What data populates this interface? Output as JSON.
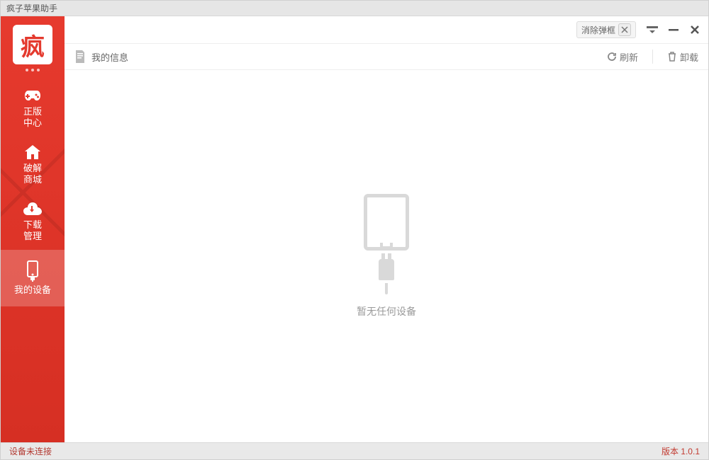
{
  "window": {
    "title": "疯子苹果助手"
  },
  "sidebar": {
    "items": [
      {
        "label": "正版\n中心"
      },
      {
        "label": "破解\n商城"
      },
      {
        "label": "下载\n管理"
      },
      {
        "label": "我的设备"
      }
    ]
  },
  "topbar": {
    "popup_label": "消除弹框"
  },
  "toolbar": {
    "title": "我的信息",
    "refresh": "刷新",
    "uninstall": "卸载"
  },
  "content": {
    "empty_text": "暂无任何设备"
  },
  "status": {
    "device": "设备未连接",
    "version_label": "版本 1.0.1"
  }
}
